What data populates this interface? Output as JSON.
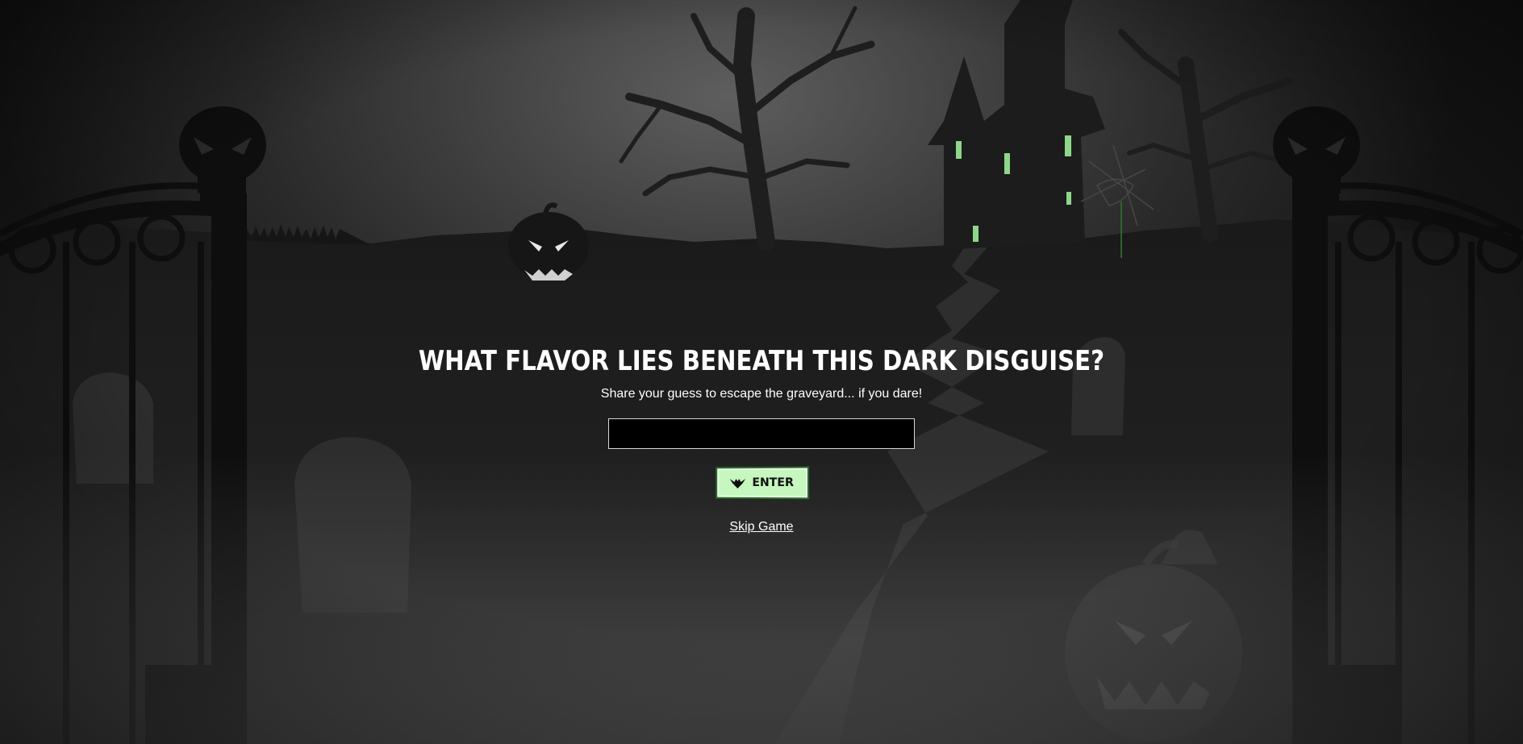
{
  "game": {
    "title": "WHAT FLAVOR LIES BENEATH THIS DARK DISGUISE?",
    "subtitle": "Share your guess to escape the graveyard... if you dare!",
    "guess_input": {
      "value": "",
      "placeholder": ""
    },
    "enter_button": {
      "label": "ENTER",
      "icon": "bat-icon"
    },
    "skip_link": "Skip Game"
  },
  "scene": {
    "elements": [
      "skull-gate-left",
      "skull-gate-right",
      "dead-tree-left",
      "dead-tree-right",
      "haunted-house",
      "jack-o-lantern-small",
      "jack-o-lantern-large",
      "tombstones",
      "spider-web",
      "winding-path",
      "fog"
    ],
    "accent_color": "#c5f7bf",
    "window_glow_color": "#8fd68a"
  }
}
